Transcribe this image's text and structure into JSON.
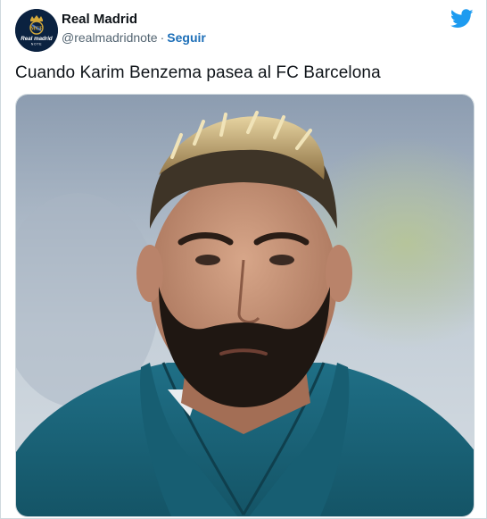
{
  "tweet": {
    "author": {
      "display_name": "Real Madrid",
      "handle": "@realmadridnote",
      "avatar_icon": "real-madrid-crest-icon",
      "avatar_text_line1": "Real madrid",
      "avatar_text_line2": "NOTE"
    },
    "separator": "·",
    "follow_label": "Seguir",
    "platform_icon": "twitter-bird-icon",
    "text": "Cuando Karim Benzema pasea al FC Barcelona",
    "media": {
      "type": "photo",
      "subject": "portrait-photo"
    },
    "colors": {
      "twitter_blue": "#1d9bf0",
      "follow_blue": "#1d6fb8",
      "avatar_bg": "#0b2240",
      "crest_gold": "#d4a93a"
    }
  }
}
